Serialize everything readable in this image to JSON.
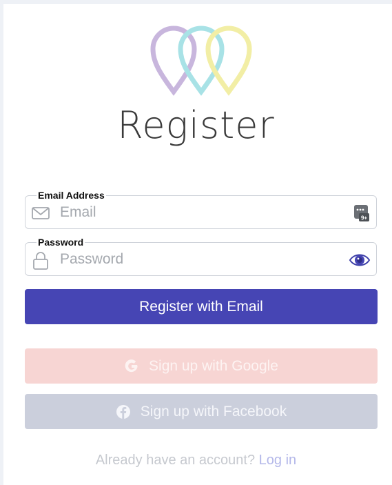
{
  "logo": {
    "icon": "location-pins-logo",
    "colors": [
      "#c8b6dd",
      "#a8e2e6",
      "#f2eea5"
    ]
  },
  "page_title": "Register",
  "email_field": {
    "label": "Email Address",
    "placeholder": "Email",
    "value": "",
    "icon": "mail-icon",
    "action_icon": "keyboard-passcode-icon"
  },
  "password_field": {
    "label": "Password",
    "placeholder": "Password",
    "value": "",
    "icon": "lock-icon",
    "action_icon": "eye-icon"
  },
  "buttons": {
    "register_email": "Register with Email",
    "google": "Sign up with Google",
    "facebook": "Sign up with Facebook"
  },
  "footer": {
    "prompt": "Already have an account?",
    "login_link": "Log in"
  },
  "colors": {
    "primary": "#4645b4",
    "google": "#f7d5d3",
    "facebook": "#cbcfdc"
  }
}
